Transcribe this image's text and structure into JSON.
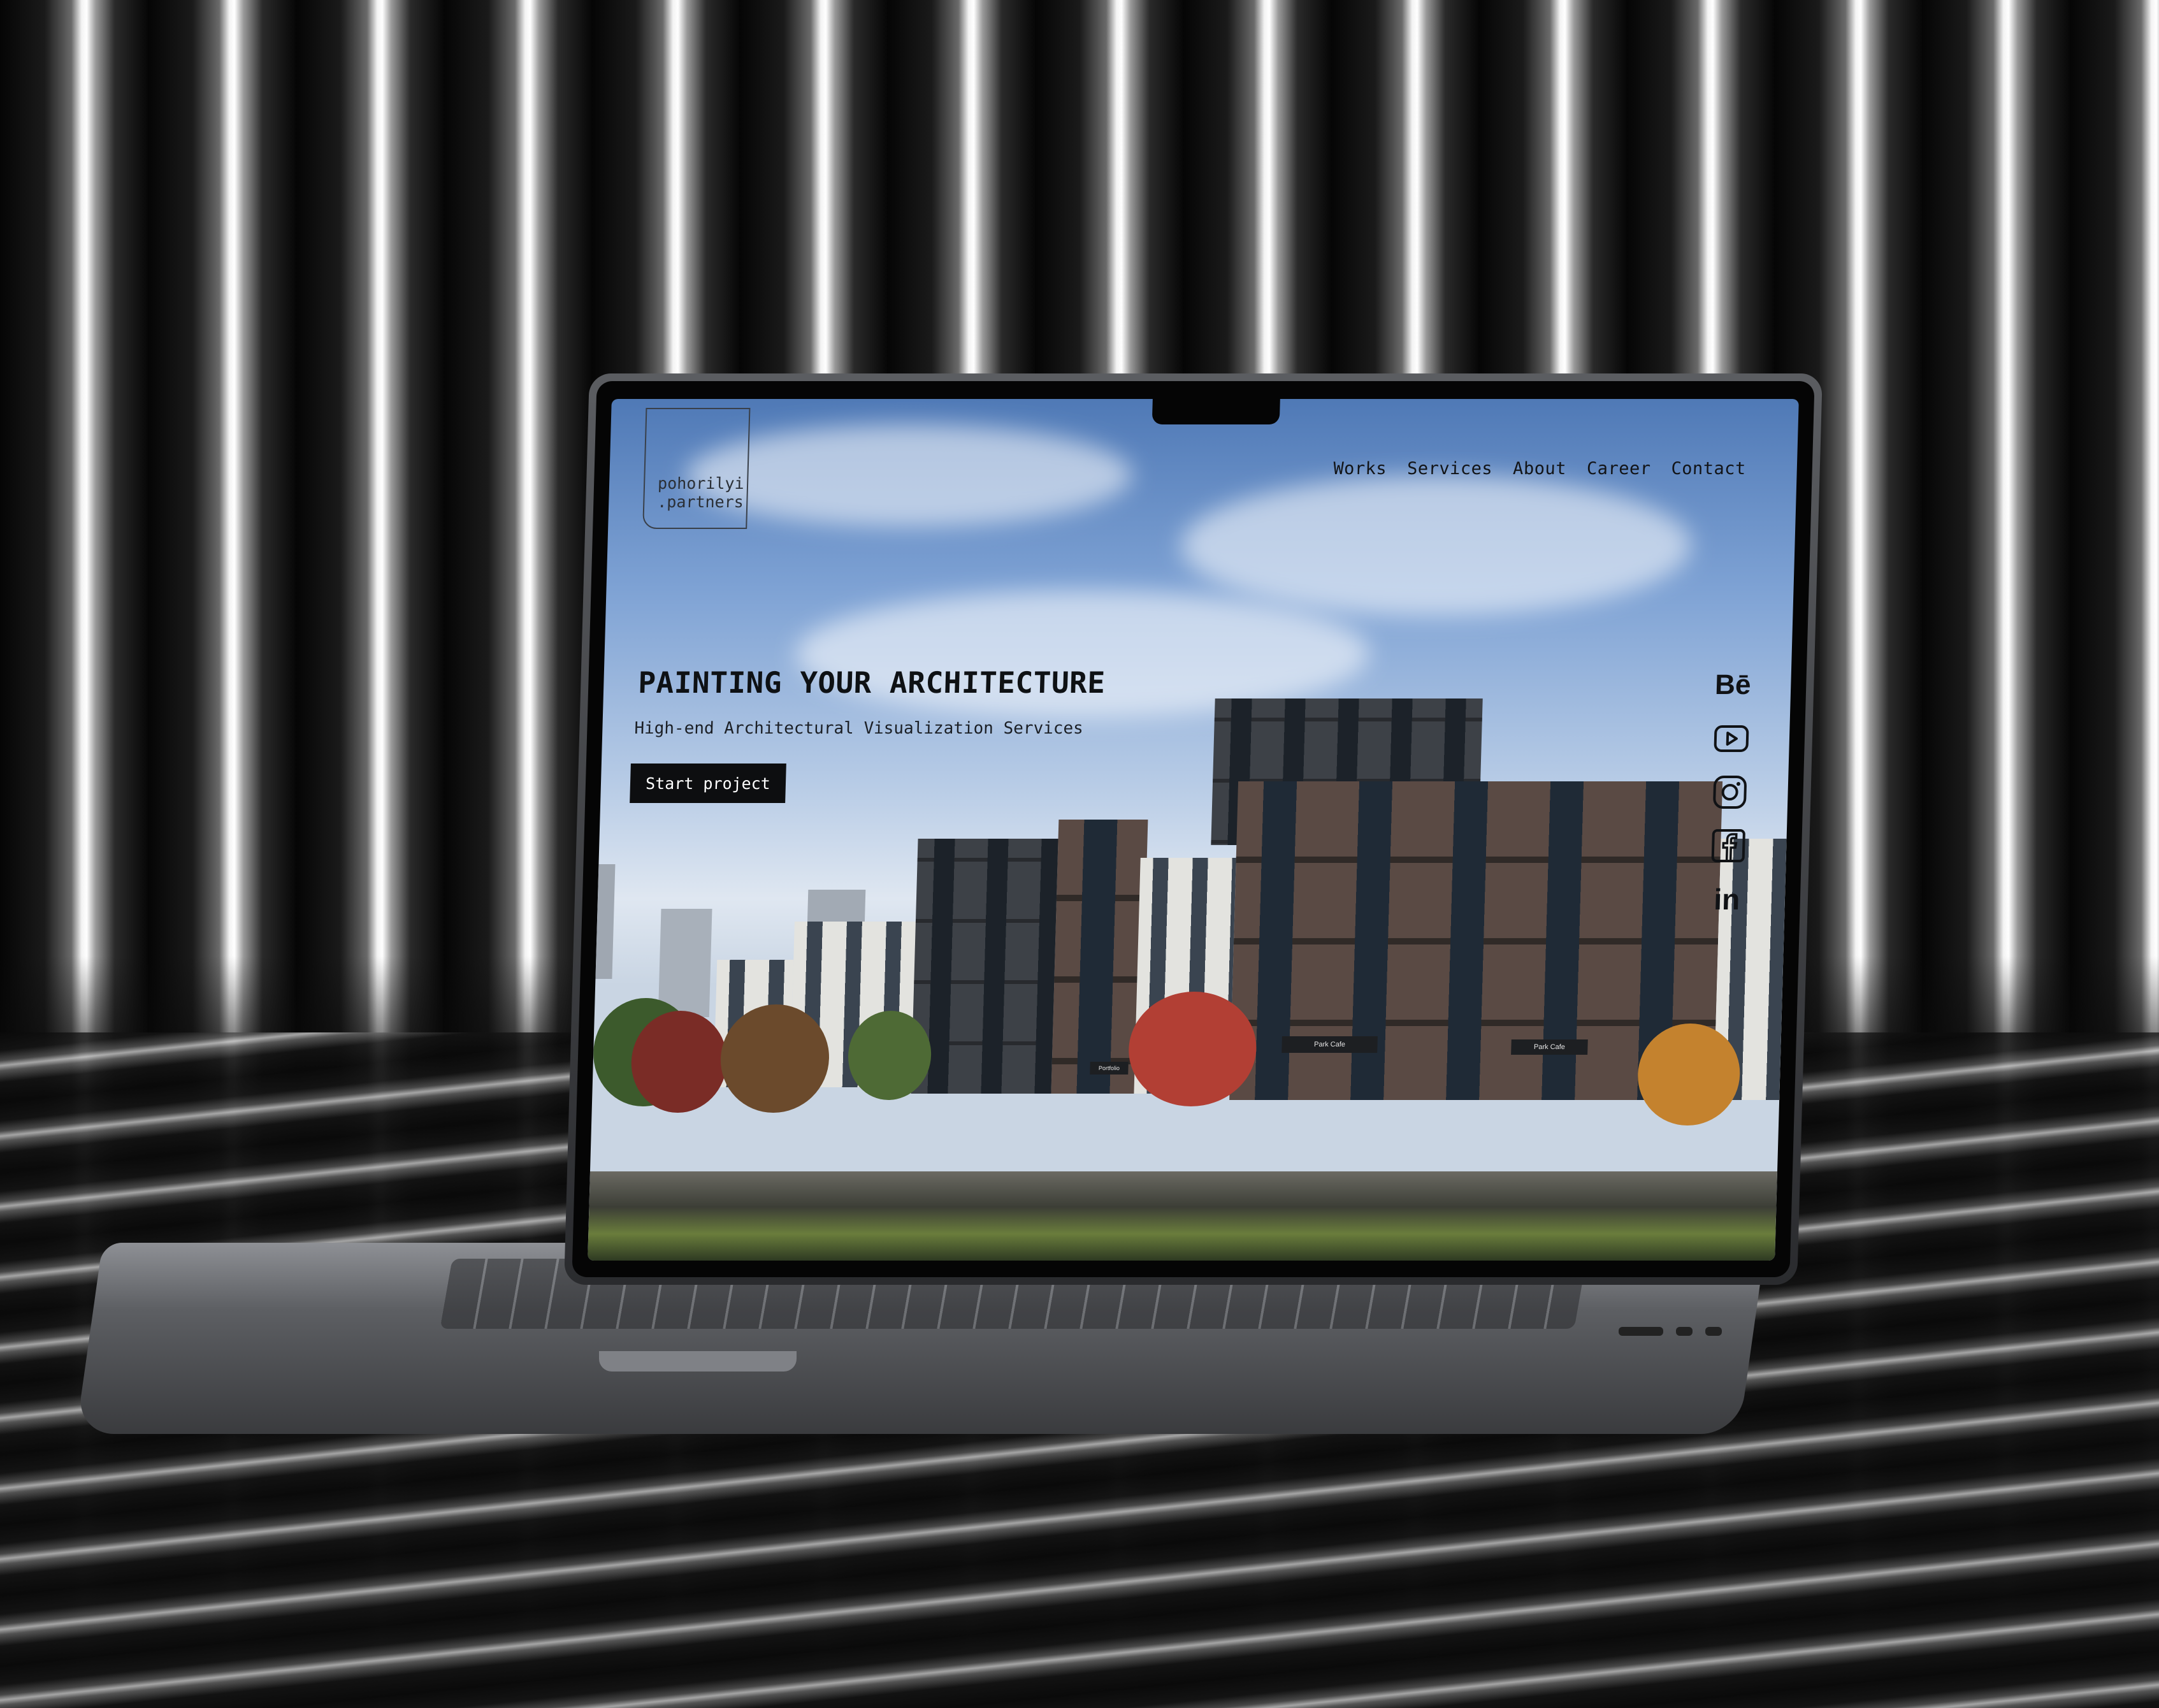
{
  "brand": {
    "line1": "pohorilyi",
    "line2": ".partners"
  },
  "nav": [
    {
      "label": "Works"
    },
    {
      "label": "Services"
    },
    {
      "label": "About"
    },
    {
      "label": "Career"
    },
    {
      "label": "Contact"
    }
  ],
  "hero": {
    "title": "PAINTING YOUR ARCHITECTURE",
    "subtitle": "High-end Architectural Visualization Services",
    "cta_label": "Start project"
  },
  "social": [
    {
      "icon": "behance-icon",
      "glyph": "Bē"
    },
    {
      "icon": "youtube-icon",
      "glyph": ""
    },
    {
      "icon": "instagram-icon",
      "glyph": ""
    },
    {
      "icon": "facebook-icon",
      "glyph": "f"
    },
    {
      "icon": "linkedin-icon",
      "glyph": "in"
    }
  ],
  "scene_signs": {
    "cafe_left": "Park Cafe",
    "cafe_right": "Park Cafe",
    "shop": "Portfolio"
  },
  "colors": {
    "cta_bg": "#0d0e10",
    "cta_text": "#ffffff",
    "text": "#121417"
  }
}
